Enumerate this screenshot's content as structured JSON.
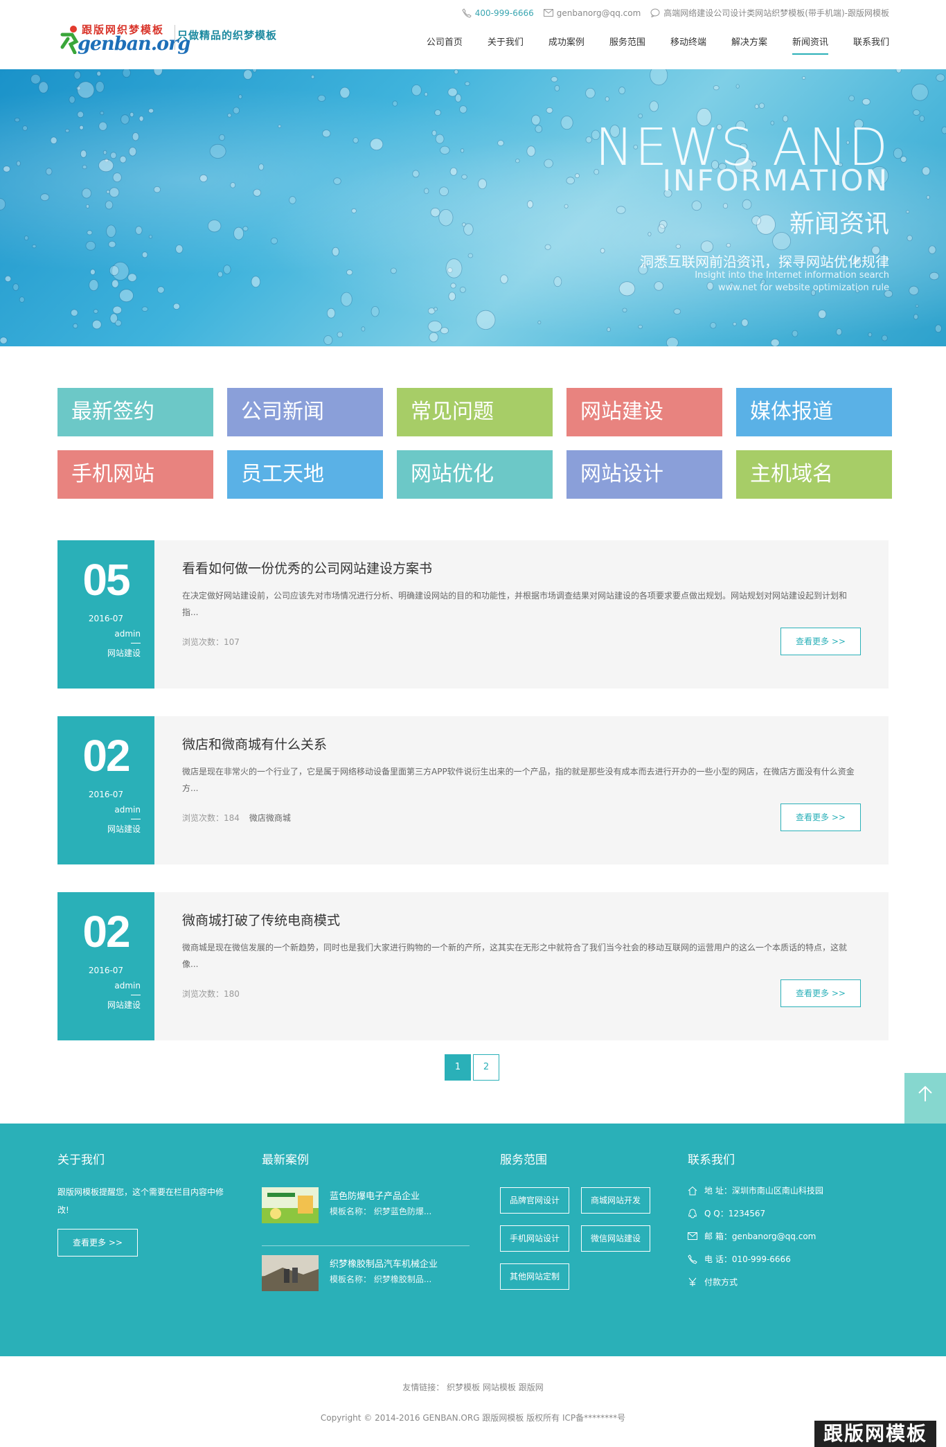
{
  "header": {
    "logo_top": "跟版网织梦模板",
    "logo_main": "genban.org",
    "slogan": "只做精品的织梦模板",
    "phone": "400-999-6666",
    "email": "genbanorg@qq.com",
    "notice": "高端网络建设公司设计类网站织梦模板(带手机端)-跟版网模板",
    "nav": [
      "公司首页",
      "关于我们",
      "成功案例",
      "服务范围",
      "移动终端",
      "解决方案",
      "新闻资讯",
      "联系我们"
    ],
    "nav_active_index": 6
  },
  "banner": {
    "en_line1": "NEWS AND",
    "en_line2": "INFORMATION",
    "cn_title": "新闻资讯",
    "sub_cn": "洞悉互联网前沿资讯，探寻网站优化规律",
    "sub_en1": "Insight into the Internet information search",
    "sub_en2": "www.net for website optimization rule"
  },
  "categories": [
    {
      "label": "最新签约",
      "color": "#6cc8c7"
    },
    {
      "label": "公司新闻",
      "color": "#8a9fd9"
    },
    {
      "label": "常见问题",
      "color": "#a7cd67"
    },
    {
      "label": "网站建设",
      "color": "#e8837f"
    },
    {
      "label": "媒体报道",
      "color": "#5ab1e6"
    },
    {
      "label": "手机网站",
      "color": "#e8837f"
    },
    {
      "label": "员工天地",
      "color": "#5ab1e6"
    },
    {
      "label": "网站优化",
      "color": "#6cc8c7"
    },
    {
      "label": "网站设计",
      "color": "#8a9fd9"
    },
    {
      "label": "主机域名",
      "color": "#a7cd67"
    }
  ],
  "news": [
    {
      "day": "05",
      "ym": "2016-07",
      "author": "admin",
      "category": "网站建设",
      "title": "看看如何做一份优秀的公司网站建设方案书",
      "desc": "在决定做好网站建设前，公司应该先对市场情况进行分析、明确建设网站的目的和功能性，并根据市场调查结果对网站建设的各项要求要点做出规划。网站规划对网站建设起到计划和指...",
      "views": "浏览次数：107",
      "tag": "",
      "more": "查看更多 >>"
    },
    {
      "day": "02",
      "ym": "2016-07",
      "author": "admin",
      "category": "网站建设",
      "title": "微店和微商城有什么关系",
      "desc": "微店是现在非常火的一个行业了，它是属于网络移动设备里面第三方APP软件说衍生出来的一个产品，指的就是那些没有成本而去进行开办的一些小型的网店，在微店方面没有什么资金方...",
      "views": "浏览次数：184",
      "tag": "微店微商城",
      "more": "查看更多 >>"
    },
    {
      "day": "02",
      "ym": "2016-07",
      "author": "admin",
      "category": "网站建设",
      "title": "微商城打破了传统电商模式",
      "desc": "微商城是现在微信发展的一个新趋势，同时也是我们大家进行购物的一个新的产所，这其实在无形之中就符合了我们当今社会的移动互联网的运营用户的这么一个本质话的特点，这就像...",
      "views": "浏览次数：180",
      "tag": "",
      "more": "查看更多 >>"
    }
  ],
  "pager": [
    "1",
    "2"
  ],
  "footer": {
    "about_title": "关于我们",
    "about_text": "跟版网模板提醒您，这个需要在栏目内容中修改!",
    "about_more": "查看更多 >>",
    "cases_title": "最新案例",
    "cases": [
      {
        "title": "蓝色防爆电子产品企业",
        "sub": "模板名称：  织梦蓝色防爆..."
      },
      {
        "title": "织梦橡胶制品汽车机械企业",
        "sub": "模板名称：  织梦橡胶制品..."
      }
    ],
    "services_title": "服务范围",
    "services": [
      "品牌官网设计",
      "商城网站开发",
      "手机网站设计",
      "微信网站建设",
      "其他网站定制"
    ],
    "contact_title": "联系我们",
    "contacts": [
      {
        "icon": "home-icon",
        "text": "地  址：深圳市南山区南山科技园"
      },
      {
        "icon": "qq-icon",
        "text": "Q Q：1234567"
      },
      {
        "icon": "mail-icon",
        "text": "邮  箱：genbanorg@qq.com"
      },
      {
        "icon": "phone-icon",
        "text": "电  话：010-999-6666"
      },
      {
        "icon": "yen-icon",
        "text": "付款方式"
      }
    ]
  },
  "bottom": {
    "links": "友情链接：  织梦模板  网站模板  跟版网",
    "copyright": "Copyright © 2014-2016 GENBAN.ORG 跟版网模板 版权所有 ICP备********号",
    "watermark": "跟版网模板"
  },
  "colors": {
    "accent": "#2ab0b8",
    "float": "#86d7cf",
    "float_close": "#8ddc95"
  }
}
